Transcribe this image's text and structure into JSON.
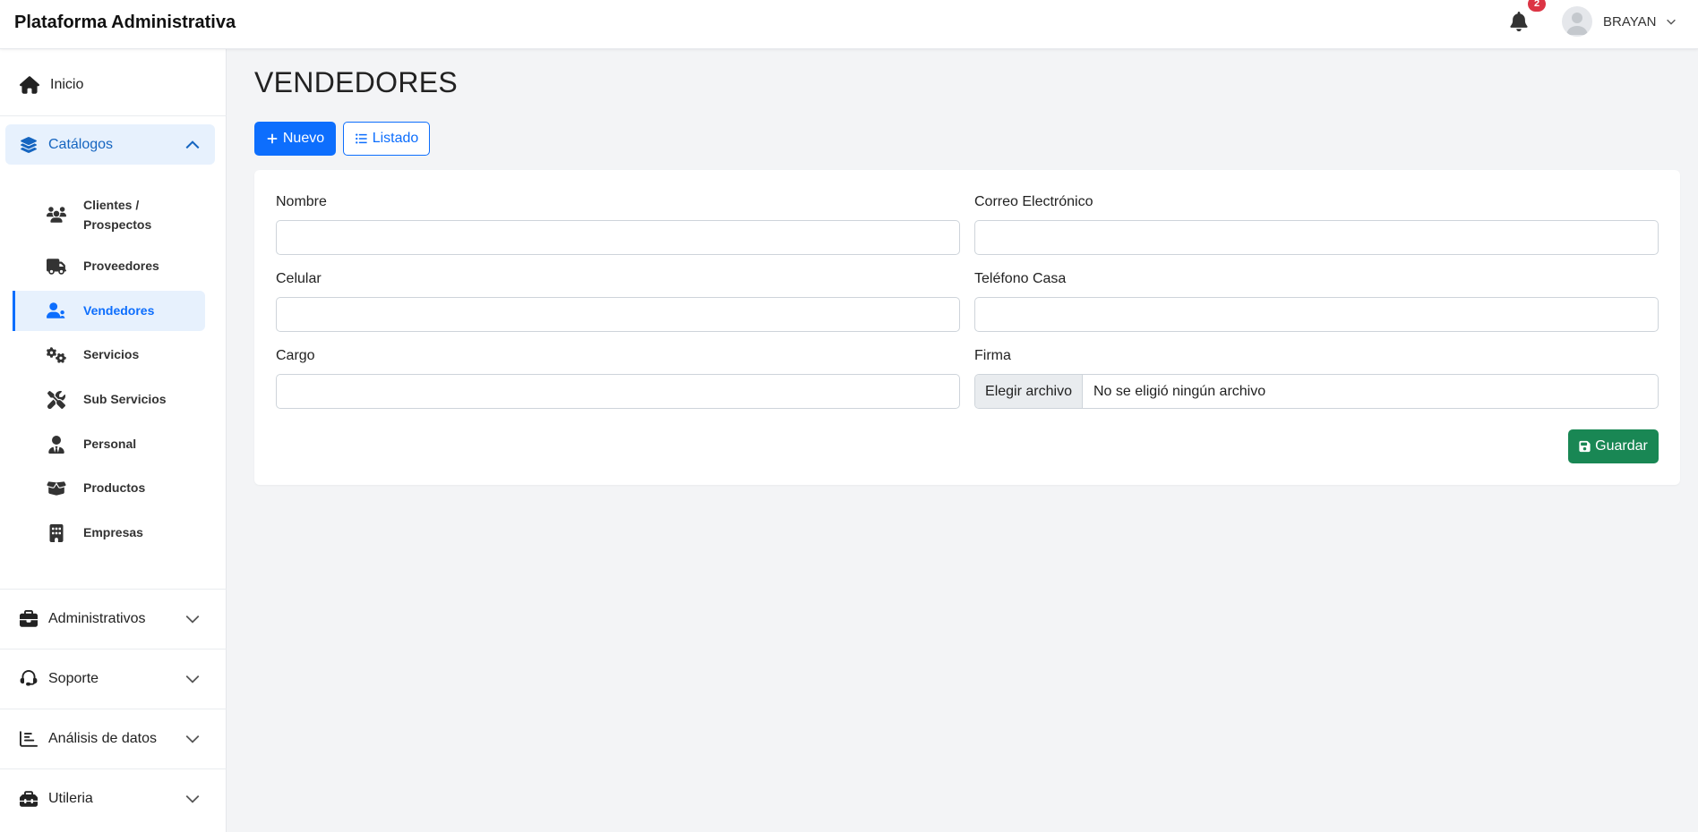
{
  "app": {
    "title": "Plataforma Administrativa"
  },
  "header": {
    "notifications_count": "2",
    "user_name": "BRAYAN"
  },
  "sidebar": {
    "home_label": "Inicio",
    "catalogs": {
      "label": "Catálogos",
      "items": [
        {
          "label_line1": "Clientes /",
          "label_line2": "Prospectos",
          "icon": "users-icon"
        },
        {
          "label": "Proveedores",
          "icon": "truck-icon"
        },
        {
          "label": "Vendedores",
          "icon": "user-tag-icon",
          "active": true
        },
        {
          "label": "Servicios",
          "icon": "gears-icon"
        },
        {
          "label": "Sub Servicios",
          "icon": "tools-icon"
        },
        {
          "label": "Personal",
          "icon": "user-tie-icon"
        },
        {
          "label": "Productos",
          "icon": "boxes-icon"
        },
        {
          "label": "Empresas",
          "icon": "building-icon"
        }
      ]
    },
    "groups": [
      {
        "label": "Administrativos",
        "icon": "briefcase-icon"
      },
      {
        "label": "Soporte",
        "icon": "headset-icon"
      },
      {
        "label": "Análisis de datos",
        "icon": "chart-bar-icon"
      },
      {
        "label": "Utileria",
        "icon": "toolbox-icon"
      }
    ]
  },
  "main": {
    "title": "VENDEDORES",
    "btn_new": "Nuevo",
    "btn_list": "Listado",
    "form": {
      "nombre_label": "Nombre",
      "nombre_value": "",
      "correo_label": "Correo Electrónico",
      "correo_value": "",
      "celular_label": "Celular",
      "celular_value": "",
      "telefono_label": "Teléfono Casa",
      "telefono_value": "",
      "cargo_label": "Cargo",
      "cargo_value": "",
      "firma_label": "Firma",
      "file_button": "Elegir archivo",
      "file_text": "No se eligió ningún archivo",
      "save_label": "Guardar"
    }
  },
  "colors": {
    "primary": "#0d6efd",
    "success": "#198754",
    "danger": "#dc3545",
    "active_bg": "#e7f1fd",
    "page_bg": "#f3f4f6"
  }
}
